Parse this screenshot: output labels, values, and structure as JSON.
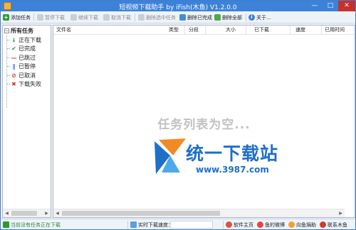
{
  "window": {
    "title": "短视频下载助手 by iFish(木鱼) V1.2.0.0",
    "minimize_glyph": "—",
    "maximize_glyph": "□",
    "close_glyph": "✕"
  },
  "toolbar": {
    "add_task": "添加任务",
    "pause": "暂停下载",
    "resume": "继续下载",
    "cancel": "取消下载",
    "delete_selected": "删除选中任务",
    "delete_completed": "删除已完成",
    "delete_all": "删除全部",
    "about": "关于..."
  },
  "tree": {
    "root": "所有任务",
    "toggle": "−",
    "items": [
      {
        "label": "正在下载",
        "icon": "download-arrow-icon",
        "color": "#2e9a2e",
        "glyph": "↓"
      },
      {
        "label": "已完成",
        "icon": "checkmark-icon",
        "color": "#2e9a2e",
        "glyph": "✔"
      },
      {
        "label": "已跳过",
        "icon": "skip-dash-icon",
        "color": "#d23a2a",
        "glyph": "—"
      },
      {
        "label": "已暂停",
        "icon": "pause-icon",
        "color": "#3a6fd2",
        "glyph": "‖"
      },
      {
        "label": "已取消",
        "icon": "cancel-circle-icon",
        "color": "#d23a2a",
        "glyph": "⊘"
      },
      {
        "label": "下载失败",
        "icon": "fail-x-icon",
        "color": "#d23a2a",
        "glyph": "✖"
      }
    ]
  },
  "list": {
    "columns": [
      "文件名",
      "类型",
      "分段",
      "大小",
      "已下载",
      "速度",
      "已用时间"
    ],
    "empty_message": "任务列表为空..."
  },
  "watermark": {
    "title": "统一下载站",
    "url": "www.3987.com"
  },
  "statusbar": {
    "status": "当前没有任务正在下载",
    "speed_label": "实时下载速度：",
    "speed_value": "",
    "links": [
      "软件主页",
      "鱼的微博",
      "向鱼捐助",
      "联系木鱼"
    ]
  },
  "colors": {
    "title_bar": "#3d82d8",
    "accent_green": "#2e9a2e",
    "accent_red": "#d23a2a",
    "empty_text": "#c2c2c2",
    "watermark_blue": "#1d6fc7",
    "status_text_green": "#2e8a2e"
  }
}
